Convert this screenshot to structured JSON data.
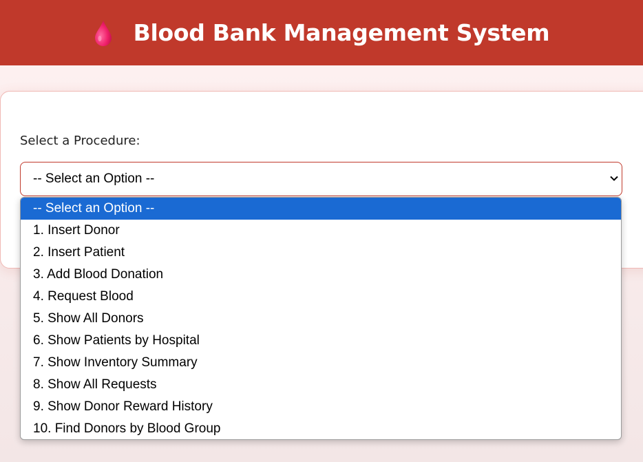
{
  "header": {
    "title": "Blood Bank Management System",
    "icon": "blood-drop-icon",
    "background": "#c0392b"
  },
  "form": {
    "label": "Select a Procedure:",
    "selected_value": "-- Select an Option --"
  },
  "dropdown": {
    "options": [
      "-- Select an Option --",
      "1. Insert Donor",
      "2. Insert Patient",
      "3. Add Blood Donation",
      "4. Request Blood",
      "5. Show All Donors",
      "6. Show Patients by Hospital",
      "7. Show Inventory Summary",
      "8. Show All Requests",
      "9. Show Donor Reward History",
      "10. Find Donors by Blood Group"
    ],
    "highlight_color": "#1a6ad3"
  }
}
